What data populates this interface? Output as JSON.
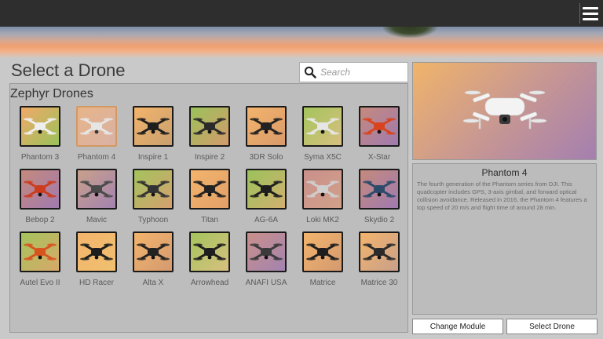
{
  "page": {
    "title": "Select a Drone"
  },
  "topbar": {
    "menu_icon": "hamburger-menu-icon"
  },
  "search": {
    "placeholder": "Search",
    "value": ""
  },
  "group": {
    "title": "Zephyr Drones",
    "drones": [
      {
        "name": "Phantom 3",
        "bg": [
          "#f1a96a",
          "#9ac25a"
        ],
        "color": "#eeeeee",
        "selected": false
      },
      {
        "name": "Phantom 4",
        "bg": [
          "#f3b27a",
          "#e2b0a0"
        ],
        "color": "#f2f2f2",
        "selected": true
      },
      {
        "name": "Inspire 1",
        "bg": [
          "#f3b46c",
          "#c9a06e"
        ],
        "color": "#1e1e1e",
        "selected": false
      },
      {
        "name": "Inspire 2",
        "bg": [
          "#9ac25a",
          "#d49a6c"
        ],
        "color": "#2a2a2a",
        "selected": false
      },
      {
        "name": "3DR Solo",
        "bg": [
          "#f3b46c",
          "#d99a6a"
        ],
        "color": "#222222",
        "selected": false
      },
      {
        "name": "Syma X5C",
        "bg": [
          "#a4c45c",
          "#d8c080"
        ],
        "color": "#e6e6e6",
        "selected": false
      },
      {
        "name": "X-Star",
        "bg": [
          "#c58a7c",
          "#a07ab0"
        ],
        "color": "#d8441f",
        "selected": false
      },
      {
        "name": "Bebop 2",
        "bg": [
          "#c58a7c",
          "#a07ab0"
        ],
        "color": "#cc3d20",
        "selected": false
      },
      {
        "name": "Mavic",
        "bg": [
          "#c9a08a",
          "#a383b0"
        ],
        "color": "#4a4a4a",
        "selected": false
      },
      {
        "name": "Typhoon",
        "bg": [
          "#a4c45c",
          "#d4a070"
        ],
        "color": "#333333",
        "selected": false
      },
      {
        "name": "Titan",
        "bg": [
          "#f3b46c",
          "#e2a068"
        ],
        "color": "#222222",
        "selected": false
      },
      {
        "name": "AG-6A",
        "bg": [
          "#9ac25a",
          "#d2b070"
        ],
        "color": "#1e1e1e",
        "selected": false
      },
      {
        "name": "Loki MK2",
        "bg": [
          "#c9908a",
          "#d2a08a"
        ],
        "color": "#cfcfcf",
        "selected": false
      },
      {
        "name": "Skydio 2",
        "bg": [
          "#c58a7c",
          "#a07ab0"
        ],
        "color": "#2d4a6a",
        "selected": false
      },
      {
        "name": "Autel Evo II",
        "bg": [
          "#a4c45c",
          "#d8a86a"
        ],
        "color": "#d8541f",
        "selected": false
      },
      {
        "name": "HD Racer",
        "bg": [
          "#f3b46c",
          "#f0c070"
        ],
        "color": "#1e1e1e",
        "selected": false
      },
      {
        "name": "Alta X",
        "bg": [
          "#f3b46c",
          "#d49a70"
        ],
        "color": "#222222",
        "selected": false
      },
      {
        "name": "Arrowhead",
        "bg": [
          "#a4c45c",
          "#d8c080"
        ],
        "color": "#1e1e1e",
        "selected": false
      },
      {
        "name": "ANAFI USA",
        "bg": [
          "#c9908a",
          "#a383b0"
        ],
        "color": "#3a3a3a",
        "selected": false
      },
      {
        "name": "Matrice",
        "bg": [
          "#f3b46c",
          "#d49a70"
        ],
        "color": "#1e1e1e",
        "selected": false
      },
      {
        "name": "Matrice 30",
        "bg": [
          "#f3b46c",
          "#c9a08a"
        ],
        "color": "#2a2a2a",
        "selected": false
      }
    ]
  },
  "preview": {
    "drone_name": "Phantom 4",
    "bg_start": "#f0b46a",
    "bg_end": "#a47fb0"
  },
  "info": {
    "title": "Phantom 4",
    "description": "The fourth generation of the Phantom series from DJI. This quadcopter includes GPS, 3-axis gimbal, and forward optical collision avoidance. Released in 2016, the Phantom 4 features a top speed of 20 m/s and flight time of around 28 min."
  },
  "buttons": {
    "change_module": "Change Module",
    "select_drone": "Select Drone"
  }
}
